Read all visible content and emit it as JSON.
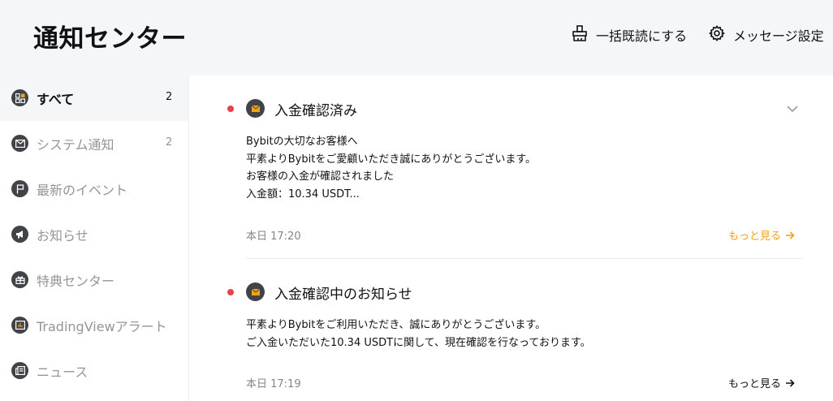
{
  "header": {
    "title": "通知センター",
    "mark_all_read_label": "一括既読にする",
    "mark_all_read_icon": "broom-icon",
    "settings_label": "メッセージ設定",
    "settings_icon": "gear-icon"
  },
  "sidebar": {
    "items": [
      {
        "label": "すべて",
        "count": "2",
        "icon": "grid-icon",
        "active": true
      },
      {
        "label": "システム通知",
        "count": "2",
        "icon": "mail-icon"
      },
      {
        "label": "最新のイベント",
        "count": "",
        "icon": "flag-icon"
      },
      {
        "label": "お知らせ",
        "count": "",
        "icon": "megaphone-icon"
      },
      {
        "label": "特典センター",
        "count": "",
        "icon": "gift-icon"
      },
      {
        "label": "TradingViewアラート",
        "count": "",
        "icon": "chart-alert-icon"
      },
      {
        "label": "ニュース",
        "count": "",
        "icon": "news-icon"
      }
    ]
  },
  "notifications": [
    {
      "title": "入金確認済み",
      "unread": true,
      "icon": "mail-icon",
      "body": [
        "Bybitの大切なお客様へ",
        "平素よりBybitをご愛顧いただき誠にありがとうございます。",
        "お客様の入金が確認されました",
        "入金額：10.34 USDT..."
      ],
      "time": "本日 17:20",
      "more_label": "もっと見る",
      "collapse_icon": "chevron-down-icon"
    },
    {
      "title": "入金確認中のお知らせ",
      "unread": true,
      "icon": "mail-icon",
      "body": [
        "平素よりBybitをご利用いただき、誠にありがとうございます。",
        "ご入金いただいた10.34 USDTに関して、現在確認を行なっております。"
      ],
      "time": "本日 17:19",
      "more_label": "もっと見る"
    }
  ],
  "colors": {
    "accent": "#f0a316",
    "unread_dot": "#e8414a",
    "header_bg": "#f5f6f8",
    "muted_text": "#929599"
  }
}
